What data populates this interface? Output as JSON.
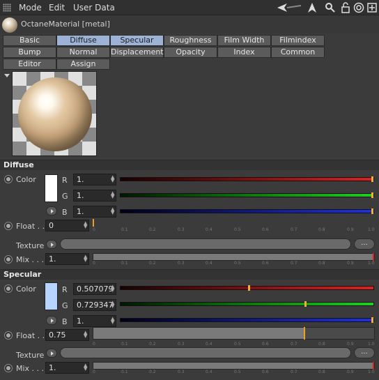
{
  "menu": {
    "items": [
      "Mode",
      "Edit",
      "User Data"
    ]
  },
  "material": {
    "title": "OctaneMaterial [metal]"
  },
  "tabs": {
    "row1": [
      "Basic",
      "Diffuse",
      "Specular",
      "Roughness",
      "Film Width",
      "Filmindex"
    ],
    "row2": [
      "Bump",
      "Normal",
      "Displacement",
      "Opacity",
      "Index",
      "Common"
    ],
    "row3": [
      "Editor",
      "Assign"
    ],
    "active": [
      "Diffuse",
      "Specular"
    ]
  },
  "diffuse": {
    "heading": "Diffuse",
    "color_label": "Color",
    "r_label": "R",
    "g_label": "G",
    "b_label": "B",
    "r": "1.",
    "g": "1.",
    "b": "1.",
    "r_fraction": 1,
    "g_fraction": 1,
    "b_fraction": 1,
    "swatch": "#ffffff",
    "float_label": "Float . .",
    "float_value": "0",
    "float_fraction": 0,
    "texture_label": "Texture",
    "texture_button": "...",
    "mix_label": "Mix . . .",
    "mix_value": "1.",
    "mix_fraction": 1
  },
  "specular": {
    "heading": "Specular",
    "color_label": "Color",
    "r_label": "R",
    "g_label": "G",
    "b_label": "B",
    "r": "0.507079",
    "g": "0.729347",
    "b": "1.",
    "r_fraction": 0.507079,
    "g_fraction": 0.729347,
    "b_fraction": 1,
    "swatch": "#b5d4ff",
    "float_label": "Float . .",
    "float_value": "0.75",
    "float_fraction": 0.75,
    "texture_label": "Texture",
    "texture_button": "...",
    "mix_label": "Mix . . .",
    "mix_value": "1.",
    "mix_fraction": 1
  },
  "ticks": [
    "0",
    "0.1",
    "0.2",
    "0.3",
    "0.4",
    "0.5",
    "0.6",
    "0.7",
    "0.8",
    "0.9",
    "1.0"
  ],
  "colors": {
    "accent_active_tab": "#9cb3d6",
    "marker": "#f0b030"
  }
}
